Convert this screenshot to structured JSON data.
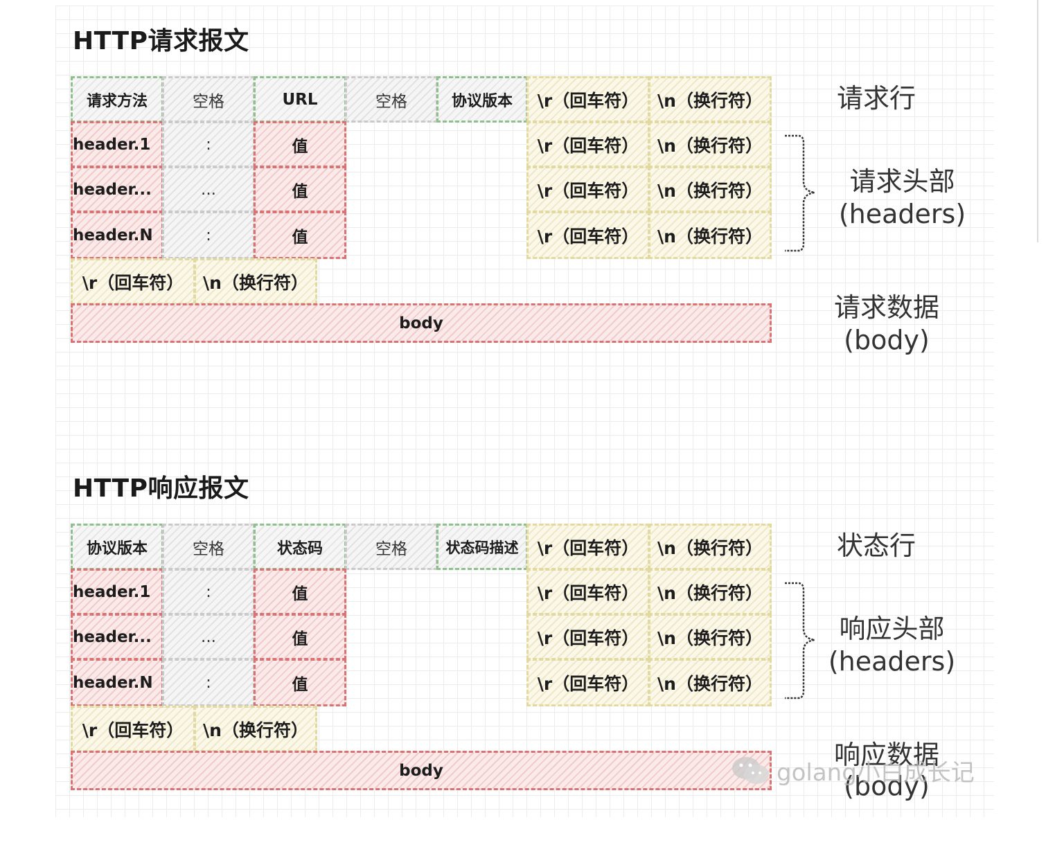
{
  "request": {
    "title": "HTTP请求报文",
    "line": [
      "请求方法",
      "空格",
      "URL",
      "空格",
      "协议版本"
    ],
    "crlf": [
      "\\r（回车符）",
      "\\n（换行符）"
    ],
    "headers": [
      {
        "name": "header.1",
        "sep": ":",
        "value": "值"
      },
      {
        "name": "header...",
        "sep": "...",
        "value": "值"
      },
      {
        "name": "header.N",
        "sep": ":",
        "value": "值"
      }
    ],
    "body": "body",
    "labels": {
      "line": "请求行",
      "headers": "请求头部",
      "headers_en": "(headers)",
      "body": "请求数据",
      "body_en": "(body)"
    }
  },
  "response": {
    "title": "HTTP响应报文",
    "line": [
      "协议版本",
      "空格",
      "状态码",
      "空格",
      "状态码描述"
    ],
    "crlf": [
      "\\r（回车符）",
      "\\n（换行符）"
    ],
    "headers": [
      {
        "name": "header.1",
        "sep": ":",
        "value": "值"
      },
      {
        "name": "header...",
        "sep": "...",
        "value": "值"
      },
      {
        "name": "header.N",
        "sep": ":",
        "value": "值"
      }
    ],
    "body": "body",
    "labels": {
      "line": "状态行",
      "headers": "响应头部",
      "headers_en": "(headers)",
      "body": "响应数据",
      "body_en": "(body)"
    }
  },
  "watermark": "golang小白成长记"
}
